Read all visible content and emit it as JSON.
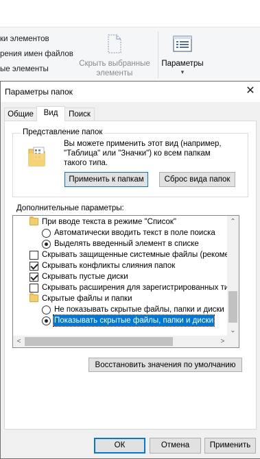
{
  "ribbon": {
    "pane_items": [
      "ки элементов",
      "рения имен файлов",
      "ые элементы"
    ],
    "hide_selected_line1": "Скрыть выбранные",
    "hide_selected_line2": "элементы",
    "options_label": "Параметры",
    "options_arrow": "▾"
  },
  "dialog": {
    "title": "Параметры папок",
    "close_glyph": "✕",
    "tabs": [
      "Общие",
      "Вид",
      "Поиск"
    ],
    "folder_views": {
      "legend": "Представление папок",
      "description": [
        "Вы можете применить этот вид (например,",
        "\"Таблица\" или \"Значки\") ко всем папкам",
        "такого типа."
      ],
      "apply_button": "Применить к папкам",
      "reset_button": "Сброс вида папок"
    },
    "advanced_label": "Дополнительные параметры:",
    "tree": [
      {
        "kind": "folder",
        "text": "При вводе текста в режиме \"Список\""
      },
      {
        "kind": "radio",
        "checked": false,
        "text": "Автоматически вводить текст в поле поиска"
      },
      {
        "kind": "radio",
        "checked": true,
        "text": "Выделять введенный элемент в списке"
      },
      {
        "kind": "check",
        "checked": false,
        "text": "Скрывать защищенные системные файлы (рекомен,"
      },
      {
        "kind": "check",
        "checked": true,
        "text": "Скрывать конфликты слияния папок"
      },
      {
        "kind": "check",
        "checked": true,
        "text": "Скрывать пустые диски"
      },
      {
        "kind": "check",
        "checked": false,
        "text": "Скрывать расширения для зарегистрированных типо"
      },
      {
        "kind": "folder",
        "text": "Скрытые файлы и папки"
      },
      {
        "kind": "radio",
        "checked": false,
        "text": "Не показывать скрытые файлы, папки и диски"
      },
      {
        "kind": "radio",
        "checked": true,
        "text": "Показывать скрытые файлы, папки и диски"
      }
    ],
    "restore_button": "Восстановить значения по умолчанию",
    "ok_button": "ОК",
    "cancel_button": "Отмена",
    "apply_button": "Применить",
    "scroll_up": "⌃",
    "scroll_down": "⌄",
    "scroll_left": "<",
    "scroll_right": ">"
  }
}
